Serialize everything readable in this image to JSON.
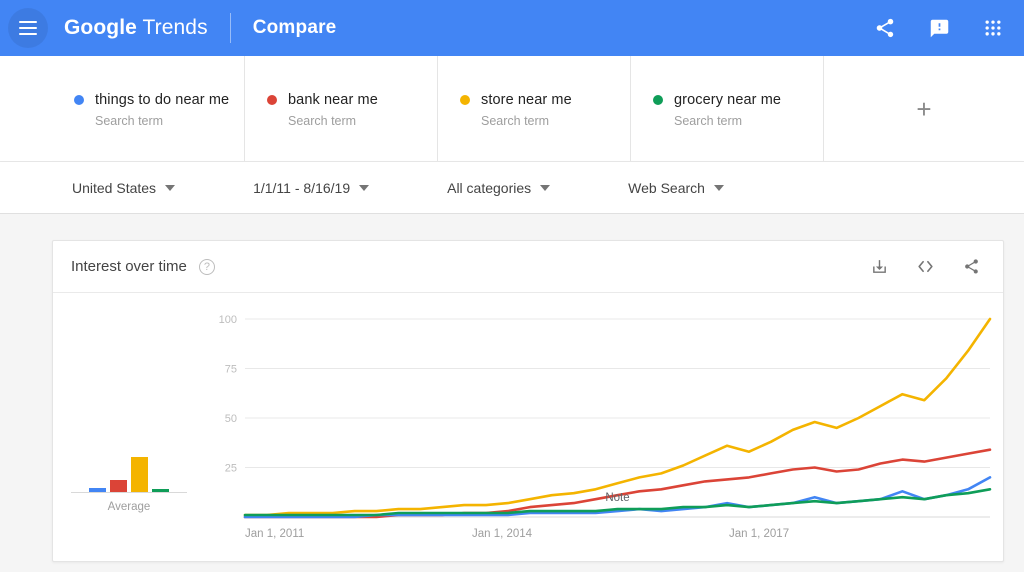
{
  "appbar": {
    "menu_icon": "hamburger-menu-icon",
    "brand_google": "Google",
    "brand_trends": "Trends",
    "section": "Compare",
    "share_icon": "share-icon",
    "feedback_icon": "feedback-icon",
    "apps_icon": "apps-grid-icon",
    "background": "#4285f4"
  },
  "terms": [
    {
      "label": "things to do near me",
      "type": "Search term",
      "color": "#4285f4"
    },
    {
      "label": "bank near me",
      "type": "Search term",
      "color": "#db4437"
    },
    {
      "label": "store near me",
      "type": "Search term",
      "color": "#f4b400"
    },
    {
      "label": "grocery near me",
      "type": "Search term",
      "color": "#0f9d58"
    }
  ],
  "add_term": {
    "label": "+",
    "icon": "plus-icon"
  },
  "filters": [
    {
      "label": "United States",
      "name": "location-filter"
    },
    {
      "label": "1/1/11 - 8/16/19",
      "name": "date-range-filter"
    },
    {
      "label": "All categories",
      "name": "category-filter"
    },
    {
      "label": "Web Search",
      "name": "search-type-filter"
    }
  ],
  "card": {
    "title": "Interest over time",
    "help_icon": "help-circle-icon",
    "download_icon": "download-icon",
    "embed_icon": "embed-code-icon",
    "share_icon": "share-icon"
  },
  "average": {
    "label": "Average",
    "values": [
      4,
      11,
      33,
      3
    ],
    "colors": [
      "#4285f4",
      "#db4437",
      "#f4b400",
      "#0f9d58"
    ]
  },
  "chart_data": {
    "type": "line",
    "title": "Interest over time",
    "xlabel": "",
    "ylabel": "",
    "ylim": [
      0,
      100
    ],
    "yticks": [
      25,
      50,
      75,
      100
    ],
    "grid": true,
    "legend_position": "top-cards",
    "xtick_labels": [
      "Jan 1, 2011",
      "Jan 1, 2014",
      "Jan 1, 2017"
    ],
    "xtick_positions": [
      0,
      0.345,
      0.69
    ],
    "annotation": {
      "label": "Note",
      "x": 0.5,
      "y": 6
    },
    "x": [
      2011.0,
      2011.25,
      2011.5,
      2011.75,
      2012.0,
      2012.25,
      2012.5,
      2012.75,
      2013.0,
      2013.25,
      2013.5,
      2013.75,
      2014.0,
      2014.25,
      2014.5,
      2014.75,
      2015.0,
      2015.25,
      2015.5,
      2015.75,
      2016.0,
      2016.25,
      2016.5,
      2016.75,
      2017.0,
      2017.25,
      2017.5,
      2017.75,
      2018.0,
      2018.25,
      2018.5,
      2018.75,
      2019.0,
      2019.25,
      2019.6
    ],
    "series": [
      {
        "name": "things to do near me",
        "color": "#4285f4",
        "values": [
          0,
          0,
          0,
          0,
          0,
          0,
          1,
          1,
          1,
          1,
          1,
          1,
          1,
          2,
          2,
          2,
          2,
          3,
          4,
          3,
          4,
          5,
          7,
          5,
          6,
          7,
          10,
          7,
          8,
          9,
          13,
          9,
          11,
          14,
          20
        ]
      },
      {
        "name": "bank near me",
        "color": "#db4437",
        "values": [
          0,
          0,
          0,
          0,
          0,
          0,
          0,
          1,
          1,
          1,
          2,
          2,
          3,
          5,
          6,
          7,
          9,
          11,
          13,
          14,
          16,
          18,
          19,
          20,
          22,
          24,
          25,
          23,
          24,
          27,
          29,
          28,
          30,
          32,
          34
        ]
      },
      {
        "name": "store near me",
        "color": "#f4b400",
        "values": [
          1,
          1,
          2,
          2,
          2,
          3,
          3,
          4,
          4,
          5,
          6,
          6,
          7,
          9,
          11,
          12,
          14,
          17,
          20,
          22,
          26,
          31,
          36,
          33,
          38,
          44,
          48,
          45,
          50,
          56,
          62,
          59,
          70,
          84,
          100
        ]
      },
      {
        "name": "grocery near me",
        "color": "#0f9d58",
        "values": [
          1,
          1,
          1,
          1,
          1,
          1,
          1,
          2,
          2,
          2,
          2,
          2,
          2,
          3,
          3,
          3,
          3,
          4,
          4,
          4,
          5,
          5,
          6,
          5,
          6,
          7,
          8,
          7,
          8,
          9,
          10,
          9,
          11,
          12,
          14
        ]
      }
    ]
  }
}
